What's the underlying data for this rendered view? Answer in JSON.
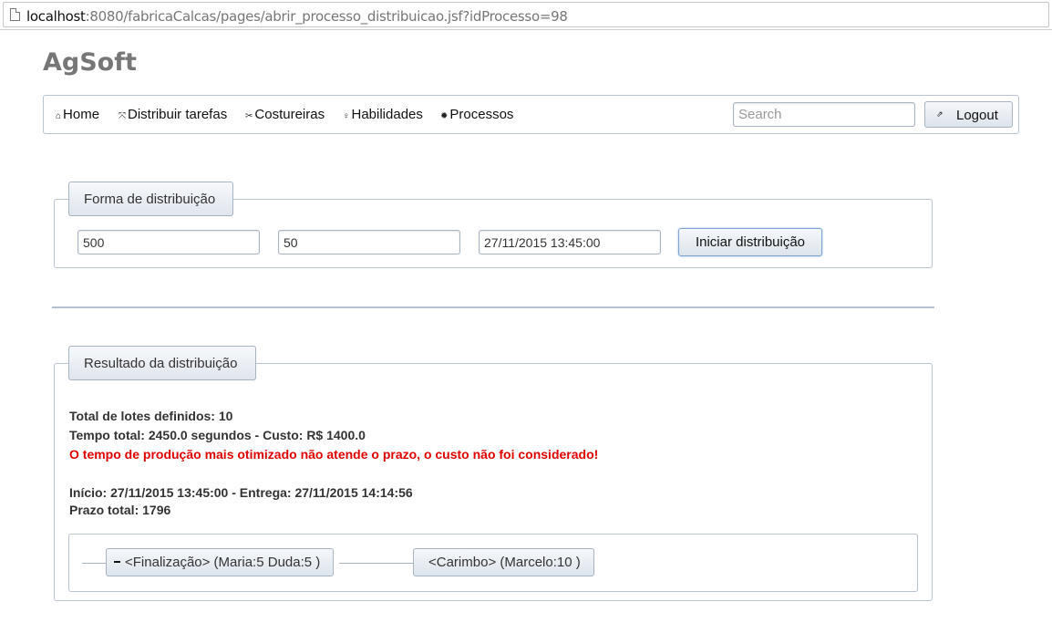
{
  "browser": {
    "url_host": "localhost",
    "url_rest": ":8080/fabricaCalcas/pages/abrir_processo_distribuicao.jsf?idProcesso=98"
  },
  "brand": "AgSoft",
  "nav": {
    "items": [
      {
        "label": "Home",
        "icon": "home-icon",
        "glyph": "⌂"
      },
      {
        "label": "Distribuir tarefas",
        "icon": "arrows-expand-icon",
        "glyph": "⤧"
      },
      {
        "label": "Costureiras",
        "icon": "scissors-icon",
        "glyph": "✂"
      },
      {
        "label": "Habilidades",
        "icon": "lightbulb-icon",
        "glyph": "♀"
      },
      {
        "label": "Processos",
        "icon": "gear-icon",
        "glyph": "✹"
      }
    ],
    "search_placeholder": "Search",
    "logout_label": "Logout",
    "logout_glyph": "⇗"
  },
  "forma": {
    "legend": "Forma de distribuição",
    "field1": "500",
    "field2": "50",
    "field3": "27/11/2015 13:45:00",
    "button": "Iniciar distribuição"
  },
  "resultado": {
    "legend": "Resultado da distribuição",
    "lines": [
      "Total de lotes definidos: 10",
      "Tempo total: 2450.0 segundos - Custo: R$ 1400.0",
      "O tempo de produção mais otimizado não atende o prazo, o custo não foi considerado!",
      "Início: 27/11/2015 13:45:00 - Entrega: 27/11/2015 14:14:56",
      "Prazo total: 1796"
    ],
    "nodes": [
      "<Finalização> (Maria:5 Duda:5 )",
      "<Carimbo> (Marcelo:10 )"
    ]
  },
  "colors": {
    "warning": "#e00000",
    "border": "#b9c3cf"
  }
}
